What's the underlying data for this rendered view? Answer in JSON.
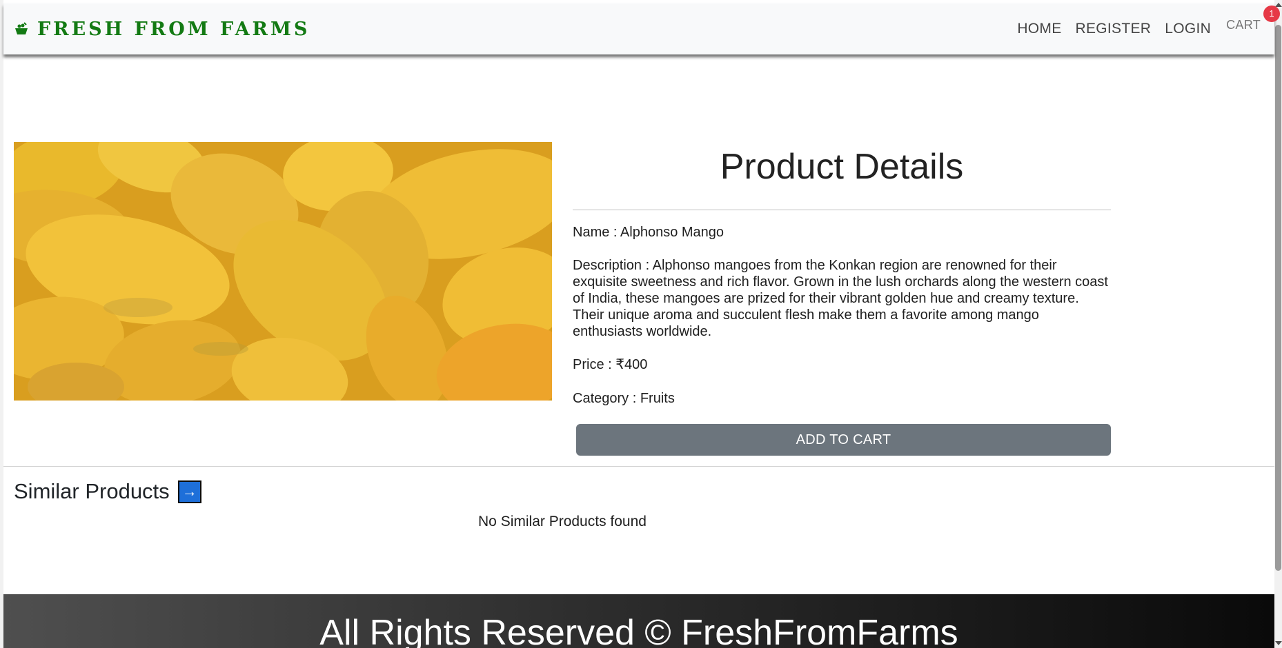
{
  "navbar": {
    "brand_icon": "basket-icon",
    "brand": "FRESH FROM FARMS",
    "links": [
      "HOME",
      "REGISTER",
      "LOGIN"
    ],
    "cart_label": "CART",
    "cart_count": "1"
  },
  "product": {
    "image_alt": "mangoes-image",
    "title": "Product Details",
    "name": "Name : Alphonso Mango",
    "description": "Description : Alphonso mangoes from the Konkan region are renowned for their exquisite sweetness and rich flavor. Grown in the lush orchards along the western coast of India, these mangoes are prized for their vibrant golden hue and creamy texture. Their unique aroma and succulent flesh make them a favorite among mango enthusiasts worldwide.",
    "price": "Price : ₹400",
    "category": "Category : Fruits",
    "add_to_cart": "ADD TO CART"
  },
  "similar": {
    "title": "Similar Products",
    "arrow_icon": "arrow-right-icon",
    "empty_message": "No Similar Products found"
  },
  "footer": {
    "text": "All Rights Reserved © FreshFromFarms"
  },
  "colors": {
    "brand_green": "#137a13",
    "button_gray": "#6c757d",
    "badge_red": "#e63946",
    "arrow_blue": "#1e6fd9"
  }
}
